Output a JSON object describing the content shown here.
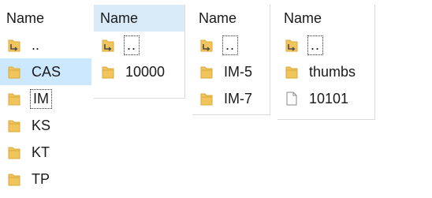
{
  "panes": [
    {
      "header": "Name",
      "rows": [
        {
          "label": "..",
          "icon": "parent-folder-icon"
        },
        {
          "label": "CAS",
          "icon": "folder-icon"
        },
        {
          "label": "IM",
          "icon": "folder-icon"
        },
        {
          "label": "KS",
          "icon": "folder-icon"
        },
        {
          "label": "KT",
          "icon": "folder-icon"
        },
        {
          "label": "TP",
          "icon": "folder-icon"
        }
      ]
    },
    {
      "header": "Name",
      "rows": [
        {
          "label": "..",
          "icon": "parent-folder-icon"
        },
        {
          "label": "10000",
          "icon": "folder-icon"
        }
      ]
    },
    {
      "header": "Name",
      "rows": [
        {
          "label": "..",
          "icon": "parent-folder-icon"
        },
        {
          "label": "IM-5",
          "icon": "folder-icon"
        },
        {
          "label": "IM-7",
          "icon": "folder-icon"
        }
      ]
    },
    {
      "header": "Name",
      "rows": [
        {
          "label": "..",
          "icon": "parent-folder-icon"
        },
        {
          "label": "thumbs",
          "icon": "folder-icon"
        },
        {
          "label": "10101",
          "icon": "file-icon"
        }
      ]
    }
  ],
  "colors": {
    "folder": "#f2c55c",
    "folder_dark": "#dba93b",
    "selected_row": "#cce8ff",
    "hot_header": "#d9ebf9",
    "parent_arrow": "#4a4a4a"
  }
}
